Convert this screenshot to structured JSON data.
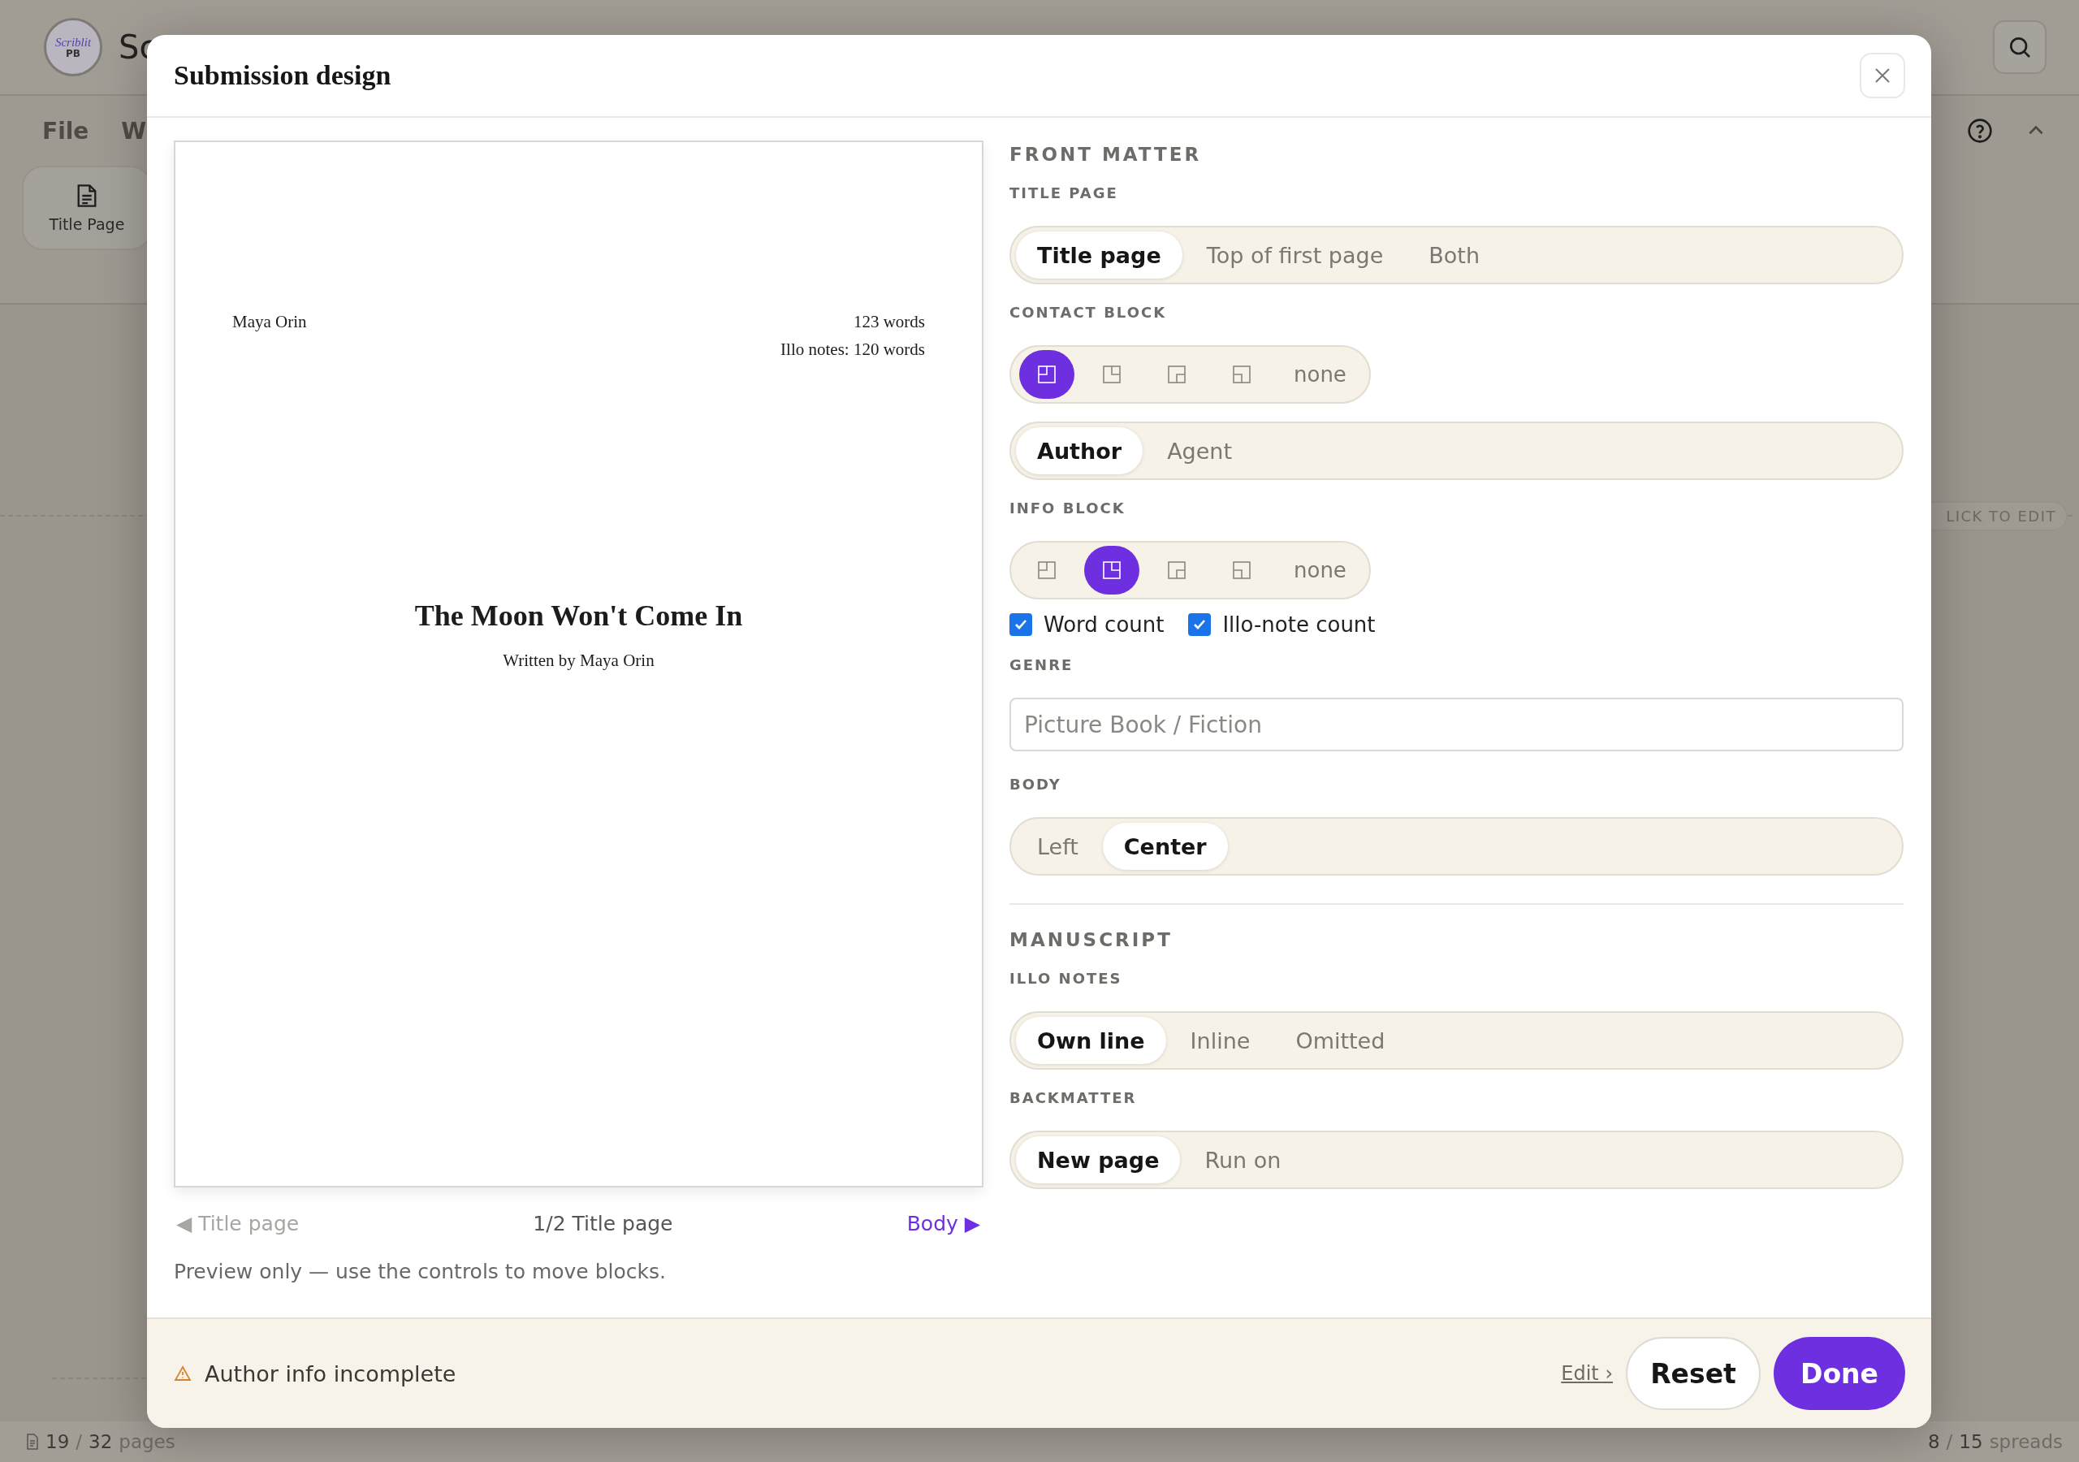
{
  "app": {
    "logo": {
      "script": "Scriblit",
      "badge": "PB"
    },
    "title": "Sc"
  },
  "menu": [
    "File",
    "W"
  ],
  "toolbar_card": {
    "label": "Title Page"
  },
  "canvas_hint": "LICK TO EDIT",
  "status_bar": {
    "pages": {
      "current": "19",
      "separator": "/",
      "total": "32",
      "unit": "pages"
    },
    "spreads": {
      "current": "8",
      "separator": "/",
      "total": "15",
      "unit": "spreads"
    }
  },
  "dialog": {
    "title": "Submission design",
    "preview": {
      "contact": "Maya Orin",
      "info": [
        "123 words",
        "Illo notes: 120 words"
      ],
      "title": "The Moon Won't Come In",
      "byline": "Written by Maya Orin"
    },
    "pager": {
      "prev": {
        "label": "◀ Title page",
        "disabled": true
      },
      "position": "1/2 Title page",
      "next": {
        "label": "Body ▶",
        "disabled": false
      }
    },
    "note": "Preview only — use the controls to move blocks.",
    "sections": [
      {
        "heading": "FRONT MATTER",
        "items": [
          {
            "kind": "label",
            "text": "TITLE PAGE"
          },
          {
            "kind": "segmented",
            "options": [
              {
                "label": "Title page",
                "selected": true
              },
              {
                "label": "Top of first page",
                "selected": false
              },
              {
                "label": "Both",
                "selected": false
              }
            ]
          },
          {
            "kind": "label",
            "text": "CONTACT BLOCK"
          },
          {
            "kind": "position",
            "options": [
              {
                "kind": "topleft",
                "selected": true
              },
              {
                "kind": "topright",
                "selected": false
              },
              {
                "kind": "bottomright",
                "selected": false
              },
              {
                "kind": "bottomleft",
                "selected": false
              },
              {
                "kind": "text",
                "label": "none",
                "selected": false
              }
            ]
          },
          {
            "kind": "segmented",
            "options": [
              {
                "label": "Author",
                "selected": true
              },
              {
                "label": "Agent",
                "selected": false
              }
            ]
          },
          {
            "kind": "label",
            "text": "INFO BLOCK"
          },
          {
            "kind": "position",
            "options": [
              {
                "kind": "topleft",
                "selected": false
              },
              {
                "kind": "topright",
                "selected": true
              },
              {
                "kind": "bottomright",
                "selected": false
              },
              {
                "kind": "bottomleft",
                "selected": false
              },
              {
                "kind": "text",
                "label": "none",
                "selected": false
              }
            ]
          },
          {
            "kind": "checkboxes",
            "options": [
              {
                "label": "Word count",
                "checked": true
              },
              {
                "label": "Illo-note count",
                "checked": true
              }
            ]
          },
          {
            "kind": "label",
            "text": "GENRE"
          },
          {
            "kind": "input",
            "placeholder": "Picture Book / Fiction"
          },
          {
            "kind": "label",
            "text": "BODY"
          },
          {
            "kind": "segmented",
            "options": [
              {
                "label": "Left",
                "selected": false
              },
              {
                "label": "Center",
                "selected": true
              }
            ]
          }
        ]
      },
      {
        "heading": "MANUSCRIPT",
        "items": [
          {
            "kind": "label",
            "text": "ILLO NOTES"
          },
          {
            "kind": "segmented",
            "options": [
              {
                "label": "Own line",
                "selected": true
              },
              {
                "label": "Inline",
                "selected": false
              },
              {
                "label": "Omitted",
                "selected": false
              }
            ]
          },
          {
            "kind": "label",
            "text": "BACKMATTER"
          },
          {
            "kind": "segmented",
            "options": [
              {
                "label": "New page",
                "selected": true
              },
              {
                "label": "Run on",
                "selected": false
              }
            ]
          }
        ]
      }
    ],
    "footer": {
      "warning": "Author info incomplete",
      "edit_link": "Edit ›",
      "reset": "Reset",
      "done": "Done"
    }
  }
}
